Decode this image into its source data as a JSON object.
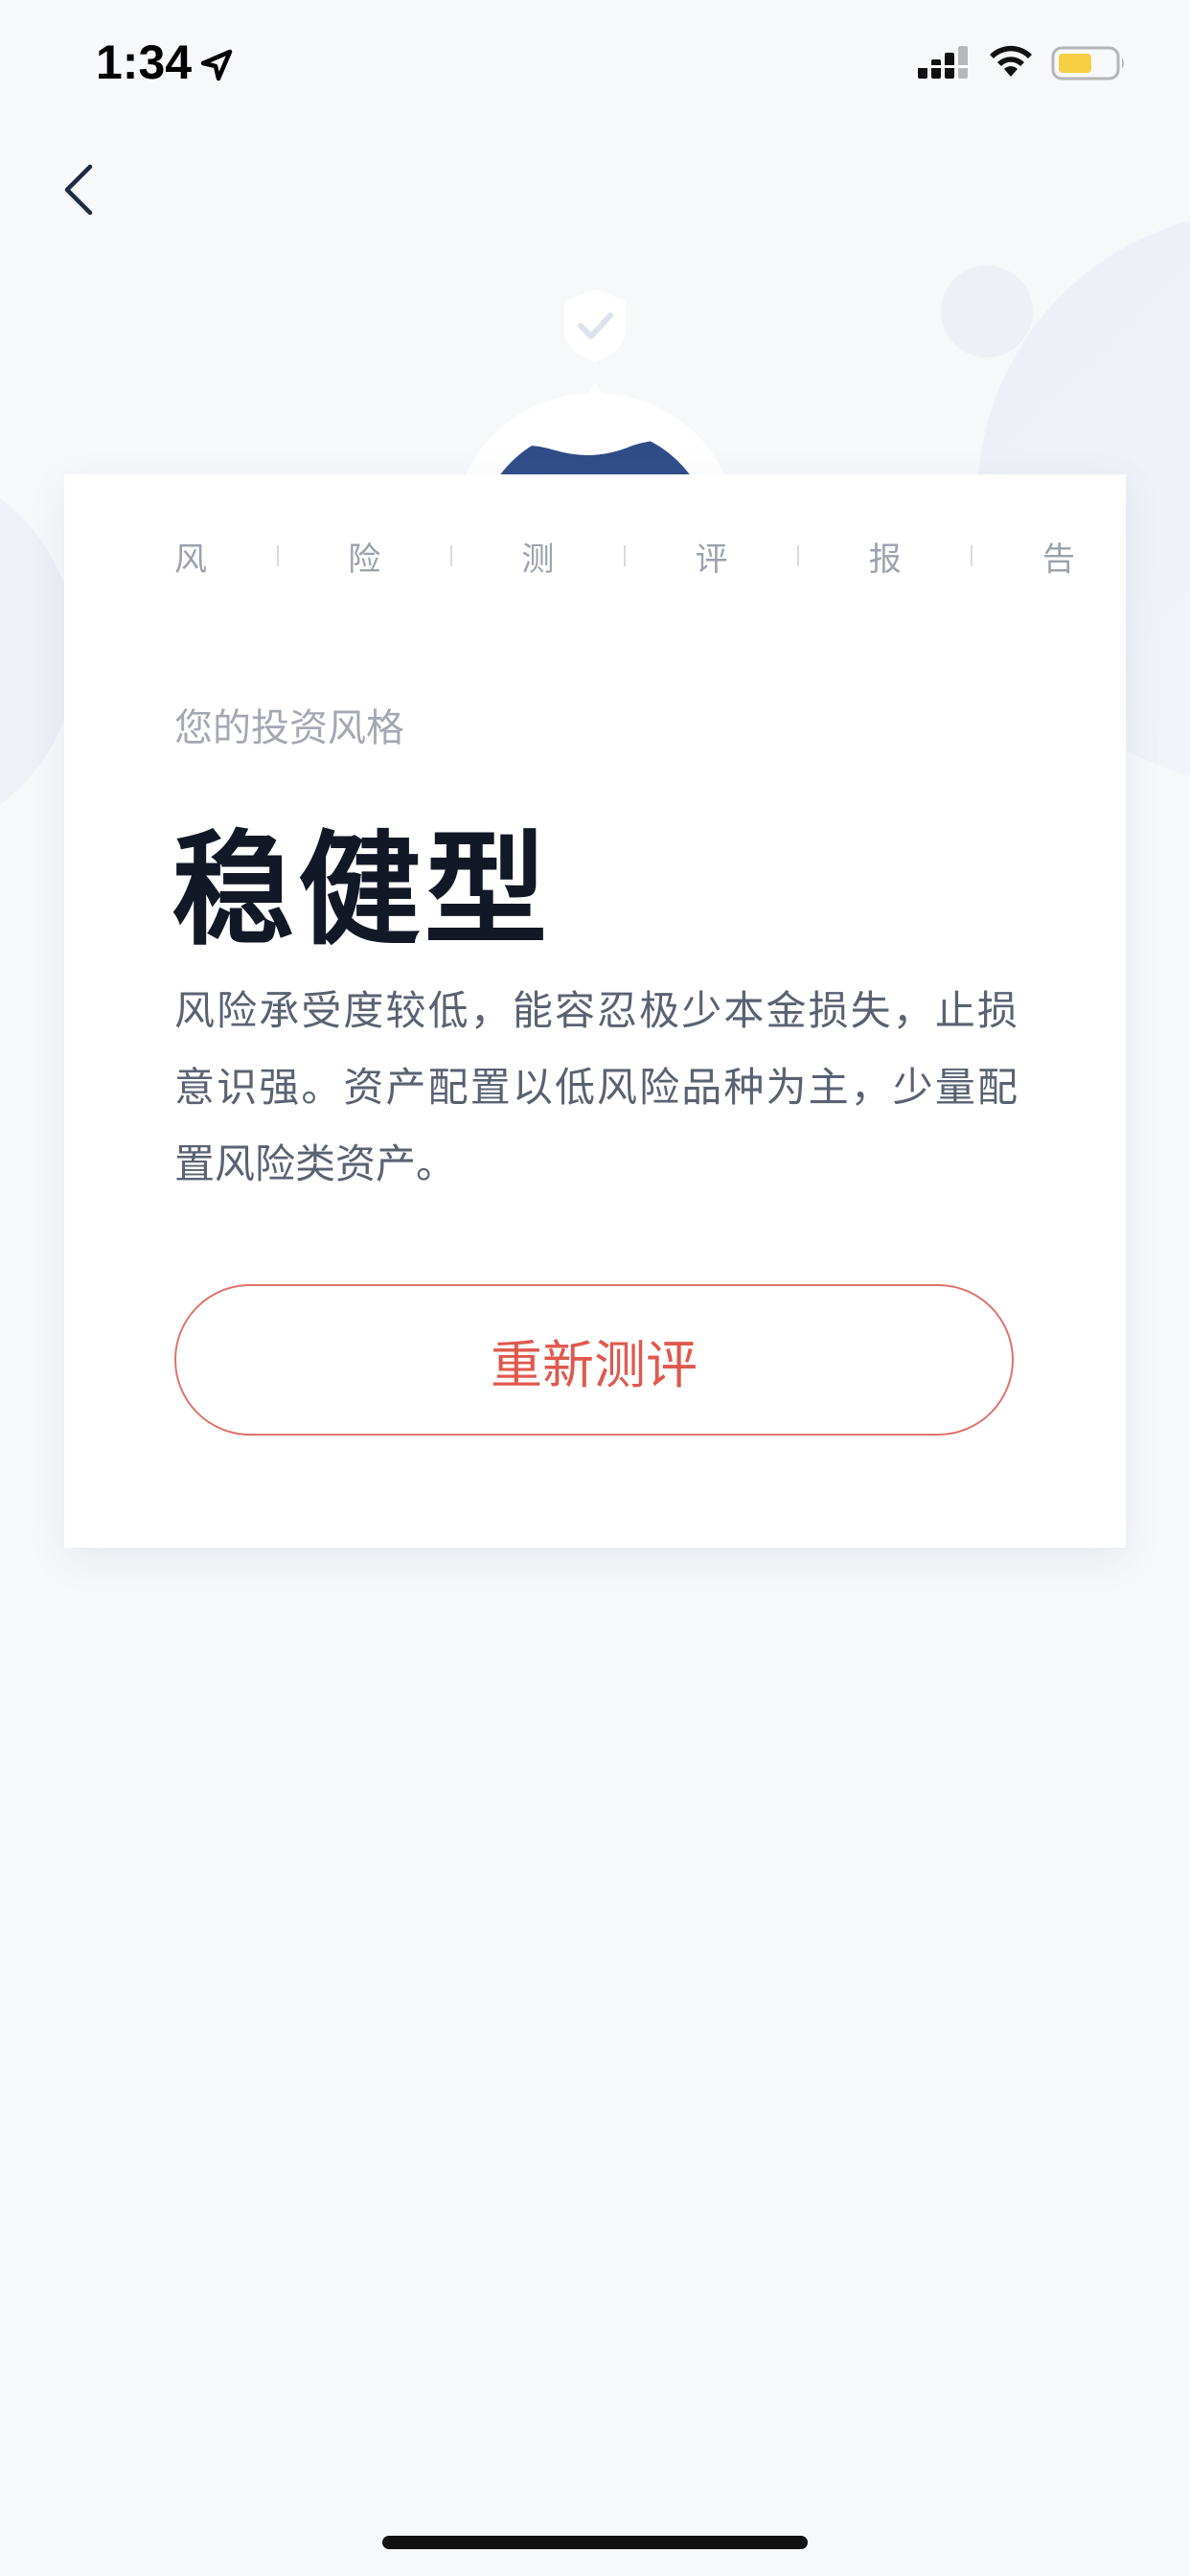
{
  "status_bar": {
    "time": "1:34",
    "icons": [
      "location-arrow-icon",
      "cellular-signal-icon",
      "wifi-icon",
      "battery-icon"
    ],
    "battery_color": "#f6cf45"
  },
  "nav": {
    "back_icon": "chevron-left-icon"
  },
  "report": {
    "heading_chars": [
      "风",
      "险",
      "测",
      "评",
      "报",
      "告"
    ],
    "style_label": "您的投资风格",
    "style_value": "稳健型",
    "description": "风险承受度较低，能容忍极少本金损失，止损意识强。资产配置以低风险品种为主，少量配置风险类资产。",
    "retest_label": "重新测评"
  },
  "colors": {
    "accent": "#e0584d",
    "title": "#121826",
    "body_text": "#5a6272",
    "muted_text": "#a3a8b3",
    "page_bg": "#f7f8fa",
    "badge_blue": "#3f5f98"
  }
}
